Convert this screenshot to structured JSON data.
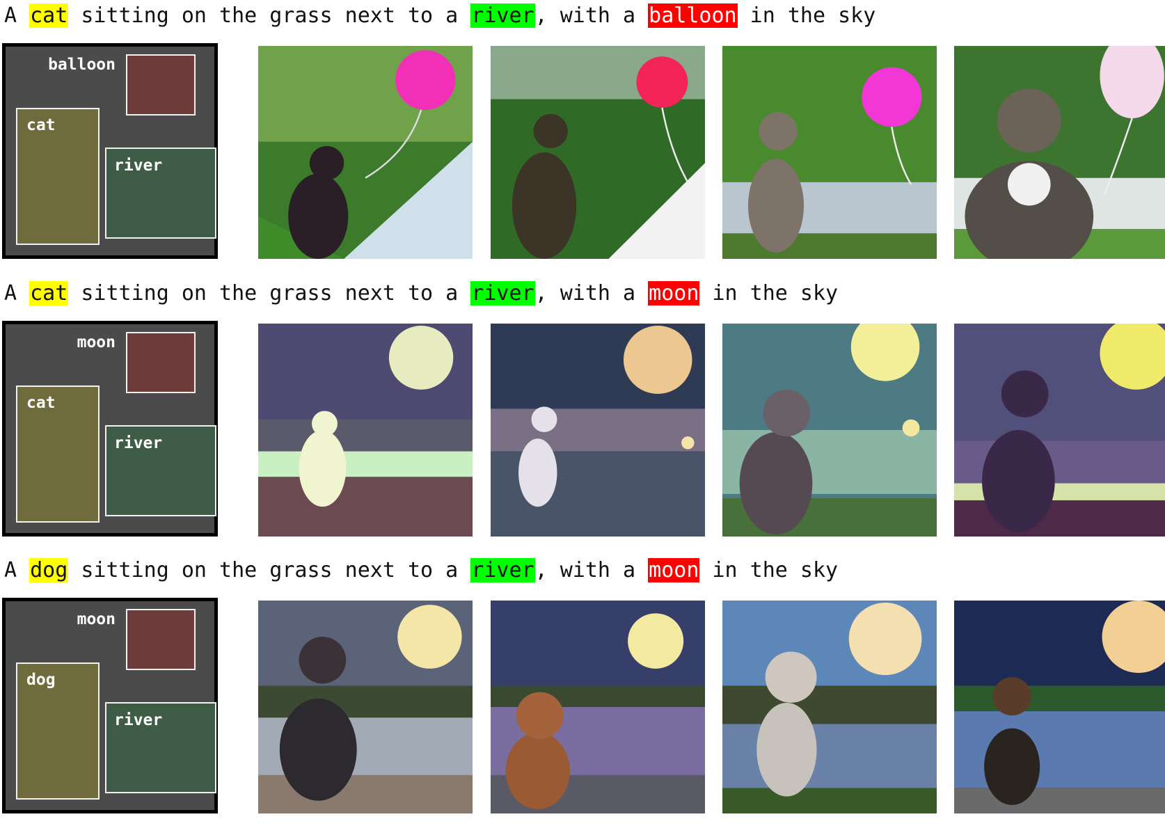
{
  "rows": [
    {
      "caption": {
        "p1": "A ",
        "subject": "cat",
        "p2": " sitting on the grass next to a ",
        "river": "river",
        "p3": ", with a ",
        "sky": "balloon",
        "p4": " in the sky"
      },
      "layout": {
        "sky": "balloon",
        "subject": "cat",
        "river": "river"
      }
    },
    {
      "caption": {
        "p1": "A ",
        "subject": "cat",
        "p2": " sitting on the grass next to a ",
        "river": "river",
        "p3": ", with a ",
        "sky": "moon",
        "p4": " in the sky"
      },
      "layout": {
        "sky": "moon",
        "subject": "cat",
        "river": "river"
      }
    },
    {
      "caption": {
        "p1": "A ",
        "subject": "dog",
        "p2": " sitting on the grass next to a ",
        "river": "river",
        "p3": ", with a ",
        "sky": "moon",
        "p4": " in the sky"
      },
      "layout": {
        "sky": "moon",
        "subject": "dog",
        "river": "river"
      }
    }
  ],
  "colors": {
    "subject_highlight": "#ffff00",
    "river_highlight": "#00ff00",
    "sky_highlight": "#ff0000",
    "layout_background": "#4b4b4b",
    "subject_box": "#6f6b3d",
    "river_box": "#3e5c46",
    "sky_box": "#6e3c3a"
  }
}
